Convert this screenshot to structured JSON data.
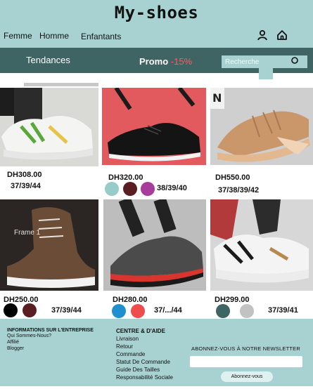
{
  "app": {
    "logo": "My-shoes"
  },
  "nav": {
    "items": [
      "Femme",
      "Homme",
      "Enfantants"
    ]
  },
  "icons": {
    "account": "user-icon",
    "home": "home-icon",
    "search": "search-icon"
  },
  "promo_bar": {
    "trend_label": "Tendances",
    "promo_label": "Promo",
    "promo_discount": "-15%",
    "search_placeholder": "Recherche"
  },
  "frame_label": "Frame 1",
  "products": [
    {
      "price": "DH308.00",
      "sizes": "37/39/44",
      "colors": []
    },
    {
      "price": "DH320.00",
      "sizes": "38/39/40",
      "colors": [
        "#98ccc9",
        "#5a1e22",
        "#a83c9c"
      ]
    },
    {
      "price": "DH550.00",
      "sizes": "37/38/39/42",
      "colors": []
    },
    {
      "price": "DH250.00",
      "sizes": "37/39/44",
      "colors": [
        "#000000",
        "#5a1e22"
      ]
    },
    {
      "price": "DH280.00",
      "sizes": "37/.../44",
      "colors": [
        "#1f8fd0",
        "#ef4d4d"
      ]
    },
    {
      "price": "DH299.00",
      "sizes": "37/39/41",
      "colors": [
        "#3f6464",
        "#c2c2c2"
      ]
    }
  ],
  "footer": {
    "company": {
      "title": "INFORMATIONS SUR L'ENTREPRISE",
      "links": [
        "Qui Sommes-Nous?",
        "Affilié",
        "Blogger"
      ]
    },
    "help": {
      "title": "CENTRE & D'AIDE",
      "links": [
        "Livraison",
        "Retour",
        "Commande",
        "Statut De Commande",
        "Guide Des Tailles",
        "Responsabilité Sociale"
      ]
    },
    "newsletter": {
      "title": "ABONNEZ-VOUS À NOTRE NEWSLETTER",
      "input_value": "",
      "button": "Abonnez-vous"
    }
  },
  "colors": {
    "header_bg": "#a8d2d2",
    "bar_bg": "#3f6464",
    "promo_red": "#ff5a5a"
  }
}
